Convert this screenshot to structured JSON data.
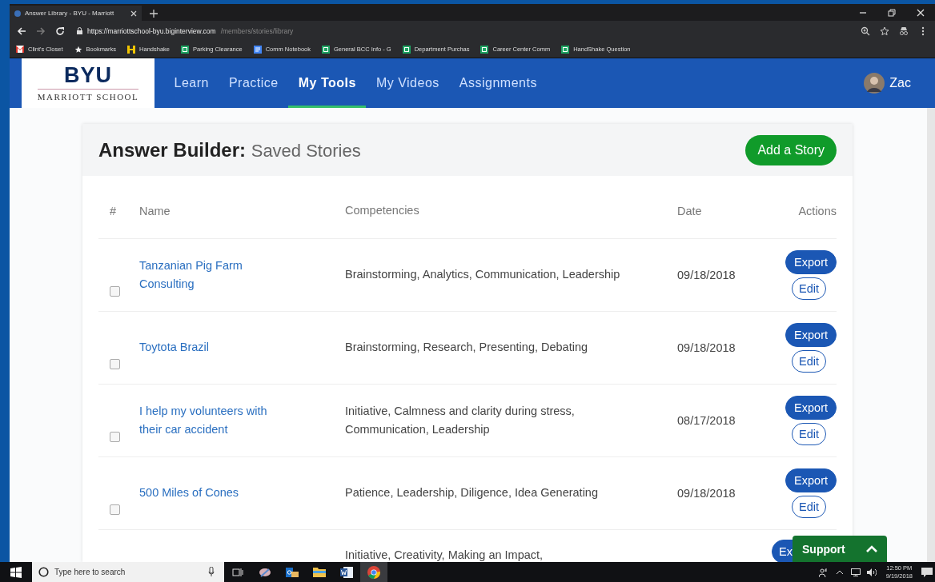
{
  "browser": {
    "tab_title": "Answer Library - BYU - Marriott",
    "url_host": "https://marriottschool-byu.biginterview.com",
    "url_path": "/members/stories/library",
    "bookmarks": [
      {
        "kind": "mail",
        "label": "Clint's Closet"
      },
      {
        "kind": "star",
        "label": "Bookmarks"
      },
      {
        "kind": "handshake",
        "label": "Handshake"
      },
      {
        "kind": "sheet",
        "label": "Parking Clearance"
      },
      {
        "kind": "doc",
        "label": "Comm Notebook"
      },
      {
        "kind": "sheet",
        "label": "General BCC Info - G"
      },
      {
        "kind": "sheet",
        "label": "Department Purchas"
      },
      {
        "kind": "sheet",
        "label": "Career Center Comm"
      },
      {
        "kind": "sheet",
        "label": "HandShake Question"
      }
    ]
  },
  "nav": {
    "logo": "BYU",
    "logo_sub": "MARRIOTT SCHOOL",
    "items": [
      {
        "label": "Learn",
        "selected": false
      },
      {
        "label": "Practice",
        "selected": false
      },
      {
        "label": "My Tools",
        "selected": true
      },
      {
        "label": "My Videos",
        "selected": false
      },
      {
        "label": "Assignments",
        "selected": false
      }
    ],
    "user": "Zac"
  },
  "header": {
    "title": "Answer Builder:",
    "subtitle": "Saved Stories",
    "button": "Add a Story"
  },
  "table": {
    "columns": [
      "#",
      "Name",
      "Competencies",
      "Date",
      "Actions"
    ],
    "rows": [
      {
        "checked": false,
        "name": "Tanzanian Pig Farm Consulting",
        "competencies": "Brainstorming, Analytics, Communication, Leadership",
        "date": "09/18/2018",
        "actions": [
          "Export",
          "Edit"
        ]
      },
      {
        "checked": false,
        "name": "Toytota Brazil",
        "competencies": "Brainstorming, Research, Presenting, Debating",
        "date": "09/18/2018",
        "actions": [
          "Export",
          "Edit"
        ]
      },
      {
        "checked": false,
        "name": "I help my volunteers with their car accident",
        "competencies": "Initiative, Calmness and clarity during stress, Communication, Leadership",
        "date": "08/17/2018",
        "actions": [
          "Export",
          "Edit"
        ]
      },
      {
        "checked": false,
        "name": "500 Miles of Cones",
        "competencies": "Patience, Leadership, Diligence, Idea Generating",
        "date": "09/18/2018",
        "actions": [
          "Export",
          "Edit"
        ]
      },
      {
        "competencies": "Initiative, Creativity, Making an Impact,",
        "actions": [
          "Ex"
        ]
      }
    ]
  },
  "support": {
    "label": "Support"
  },
  "taskbar": {
    "search_placeholder": "Type here to search",
    "time": "12:50 PM",
    "date": "9/19/2018"
  }
}
